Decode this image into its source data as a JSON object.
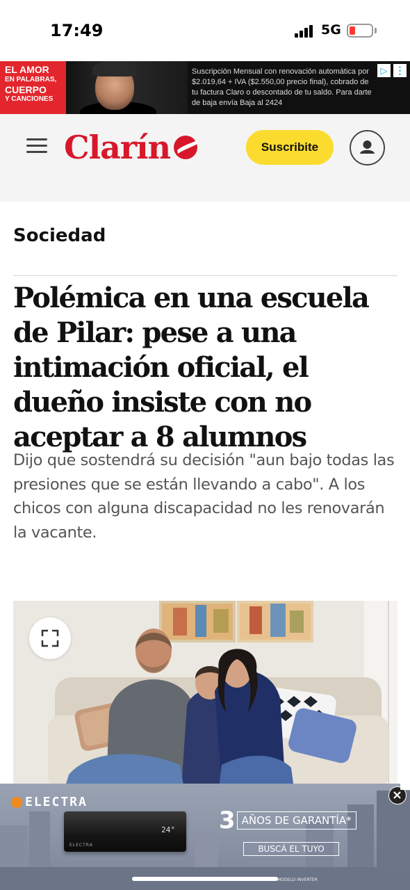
{
  "status_bar": {
    "time": "17:49",
    "network": "5G"
  },
  "top_ad": {
    "brand_lines": [
      "EL AMOR",
      "EN PALABRAS,",
      "CUERPO",
      "Y CANCIONES"
    ],
    "text": "Suscripción Mensual con renovación automática por $2.019,64 + IVA ($2.550,00 precio final), cobrado de tu factura Claro o descontado de tu saldo. Para darte de baja envía Baja al 2424",
    "adchoices_icon": "adchoices-icon",
    "menu_icon": "kebab-icon"
  },
  "header": {
    "logo_text": "Clarín",
    "subscribe_label": "Suscribite",
    "brand_color": "#d7182a",
    "button_color": "#fbdb2e"
  },
  "article": {
    "section": "Sociedad",
    "headline": "Polémica en una escuela de Pilar: pese a una intimación oficial, el dueño insiste con no aceptar a 8 alumnos",
    "summary": "Dijo que sostendrá su decisión \"aun bajo todas las presiones que se están llevando a cabo\". A los chicos con alguna discapacidad no les renovarán la vacante."
  },
  "bottom_ad": {
    "brand": "ELECTRA",
    "display": "24°",
    "unit_brand": "ELECTRA",
    "warranty_number": "3",
    "warranty_text": "AÑOS DE GARANTÍA*",
    "cta": "BUSCÁ EL TUYO",
    "fine_print": "*EN MODELO INVERTER",
    "accent_color": "#f08a1c"
  }
}
